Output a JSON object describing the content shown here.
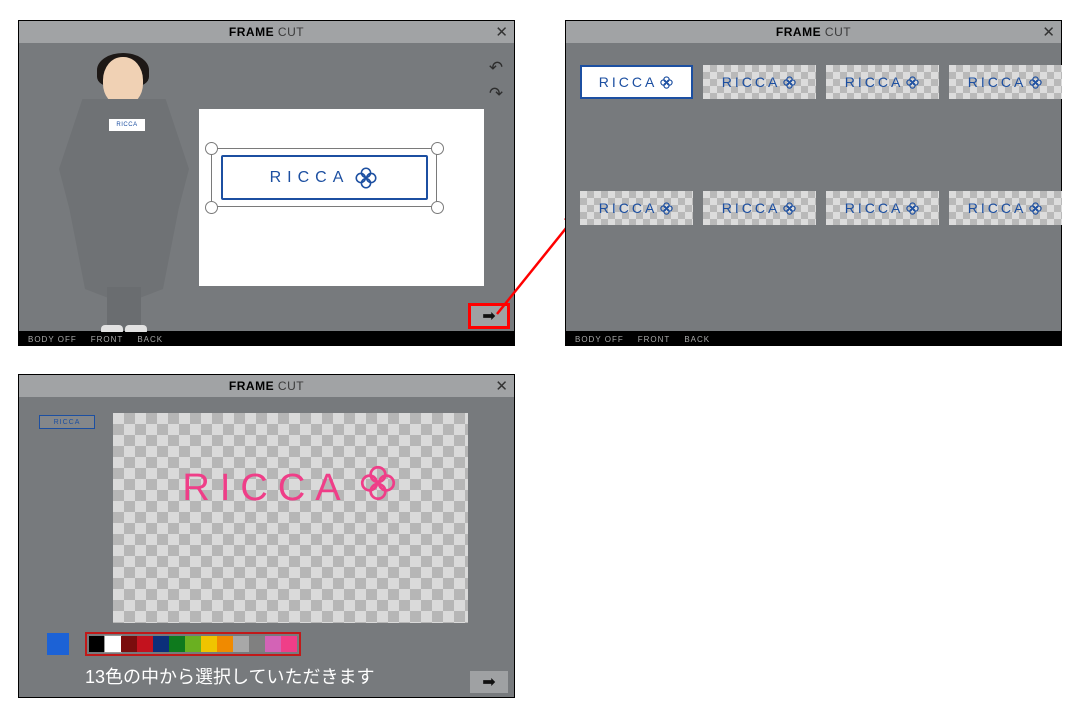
{
  "panel_title_bold": "FRAME",
  "panel_title_thin": "CUT",
  "logo_text": "RICCA",
  "avatar_tag": "RICCA",
  "strip_items": [
    "BODY OFF",
    "FRONT",
    "BACK"
  ],
  "palette_caption": "13色の中から選択していただきます",
  "palette_colors": [
    "#000000",
    "#ffffff",
    "#7a0d0d",
    "#c3121e",
    "#0c2f7a",
    "#0e7a1d",
    "#6ab021",
    "#f0c400",
    "#f08a00",
    "#a8a8a8",
    "#808080",
    "#d363b6",
    "#ef3e88"
  ],
  "current_color": "#1c62d6",
  "thumbs_row1_white_first": true,
  "thumb_count_row": 4
}
